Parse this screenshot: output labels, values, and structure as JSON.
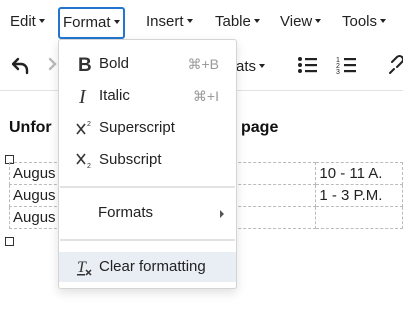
{
  "menubar": {
    "edit": "Edit",
    "format": "Format",
    "insert": "Insert",
    "table": "Table",
    "view": "View",
    "tools": "Tools"
  },
  "toolbar": {
    "formats_label": "ats",
    "undo_icon": "undo-icon",
    "redo_icon": "redo-icon",
    "bullet_icon": "bullet-list-icon",
    "numbered_icon": "numbered-list-icon",
    "link_icon": "link-icon"
  },
  "editor": {
    "heading_start": "Unfor",
    "heading_end": "page",
    "rows": [
      [
        "Augus",
        "10 - 11 A."
      ],
      [
        "Augus",
        "1 - 3 P.M."
      ],
      [
        "Augus",
        ""
      ]
    ]
  },
  "format_menu": {
    "items": [
      {
        "label": "Bold",
        "shortcut": "⌘+B",
        "icon": "bold-icon"
      },
      {
        "label": "Italic",
        "shortcut": "⌘+I",
        "icon": "italic-icon"
      },
      {
        "label": "Superscript",
        "shortcut": "",
        "icon": "superscript-icon"
      },
      {
        "label": "Subscript",
        "shortcut": "",
        "icon": "subscript-icon"
      },
      {
        "label": "Formats",
        "shortcut": "",
        "icon": "chevron-right-icon"
      },
      {
        "label": "Clear formatting",
        "shortcut": "",
        "icon": "clear-formatting-icon"
      }
    ]
  },
  "colors": {
    "accent": "#2276d2",
    "hover": "#e9eef5",
    "separator": "#e2e2e2",
    "shortcut": "#9a9a9a"
  }
}
